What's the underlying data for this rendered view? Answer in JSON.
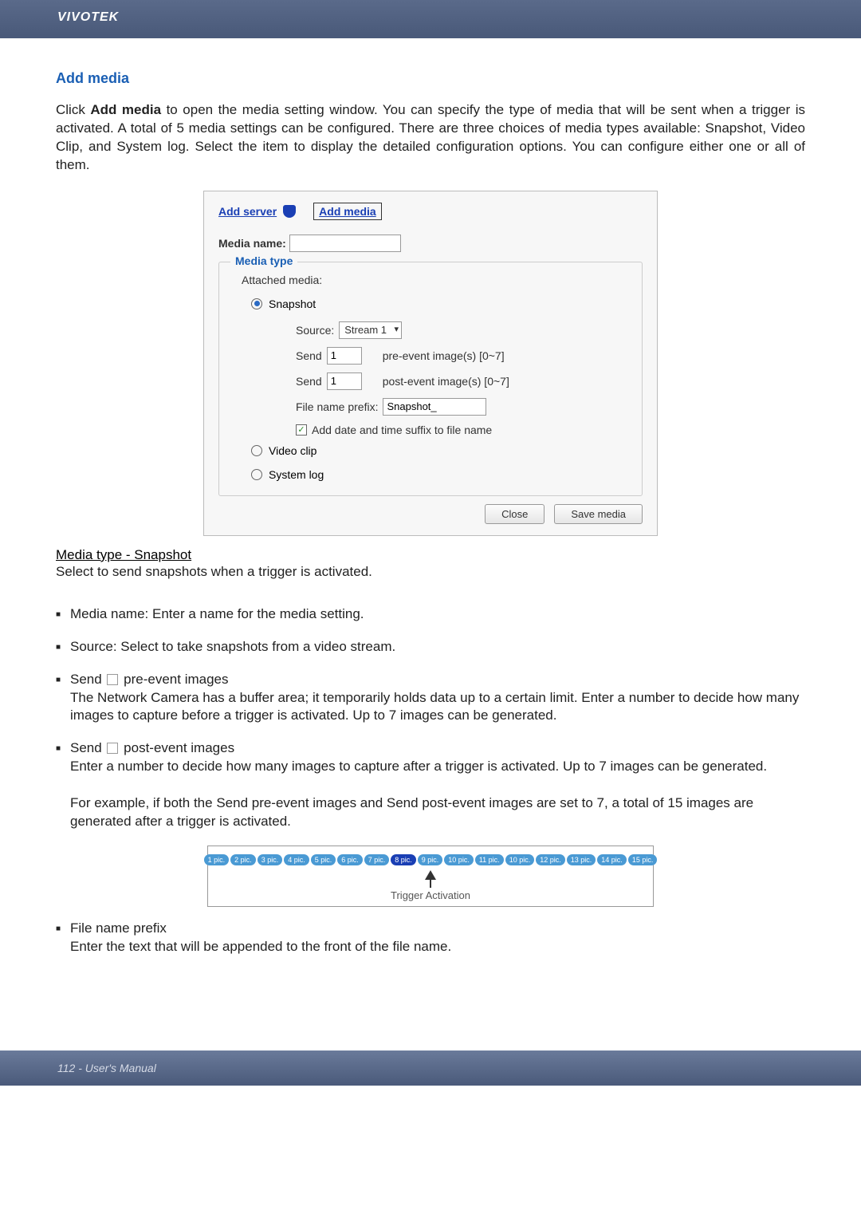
{
  "brand": "VIVOTEK",
  "section_title": "Add media",
  "intro_prefix": "Click ",
  "intro_bold": "Add media",
  "intro_rest": " to open the media setting window. You can specify the type of media that will be sent when a trigger is activated. A total of 5 media settings can be configured. There are three choices of media types available: Snapshot, Video Clip, and System log. Select the item to display the detailed configuration options. You can configure either one or all of them.",
  "dialog": {
    "add_server": "Add server",
    "add_media": "Add media",
    "media_name_label": "Media name:",
    "media_name_value": "",
    "legend": "Media type",
    "attached": "Attached media:",
    "snapshot": "Snapshot",
    "source_label": "Source:",
    "source_value": "Stream 1",
    "send1_a": "Send",
    "send1_val": "1",
    "send1_b": "pre-event image(s) [0~7]",
    "send2_a": "Send",
    "send2_val": "1",
    "send2_b": "post-event image(s) [0~7]",
    "prefix_label": "File name prefix:",
    "prefix_value": "Snapshot_",
    "suffix_chk": "Add date and time suffix to file name",
    "video_clip": "Video clip",
    "system_log": "System log",
    "close": "Close",
    "save": "Save media"
  },
  "subtitle": "Media type - Snapshot",
  "subdesc": "Select to send snapshots when a trigger is activated.",
  "bullets": {
    "b1": "Media name: Enter a name for the media setting.",
    "b2": "Source: Select to take snapshots from a video stream.",
    "b3_head": "Send ",
    "b3_tail": " pre-event images",
    "b3_body": "The Network Camera has a buffer area; it temporarily holds data up to a certain limit. Enter a number to decide how many images to capture before a trigger is activated. Up to 7 images can be generated.",
    "b4_head": "Send ",
    "b4_tail": " post-event images",
    "b4_body1": "Enter a number to decide how many images to capture after a trigger is activated. Up to 7 images can be generated.",
    "b4_body2": "For example, if both the Send pre-event images and Send post-event images are set to 7, a total of 15 images are generated after a trigger is activated.",
    "b5_head": "File name prefix",
    "b5_body": "Enter the text that will be appended to the front of the file name."
  },
  "diagram": {
    "pills": [
      "1 pic.",
      "2 pic.",
      "3 pic.",
      "4 pic.",
      "5 pic.",
      "6 pic.",
      "7 pic.",
      "8 pic.",
      "9 pic.",
      "10 pic.",
      "11 pic.",
      "10 pic.",
      "12 pic.",
      "13 pic.",
      "14 pic.",
      "15 pic."
    ],
    "active_index": 7,
    "label": "Trigger Activation"
  },
  "footer": "112 - User's Manual"
}
